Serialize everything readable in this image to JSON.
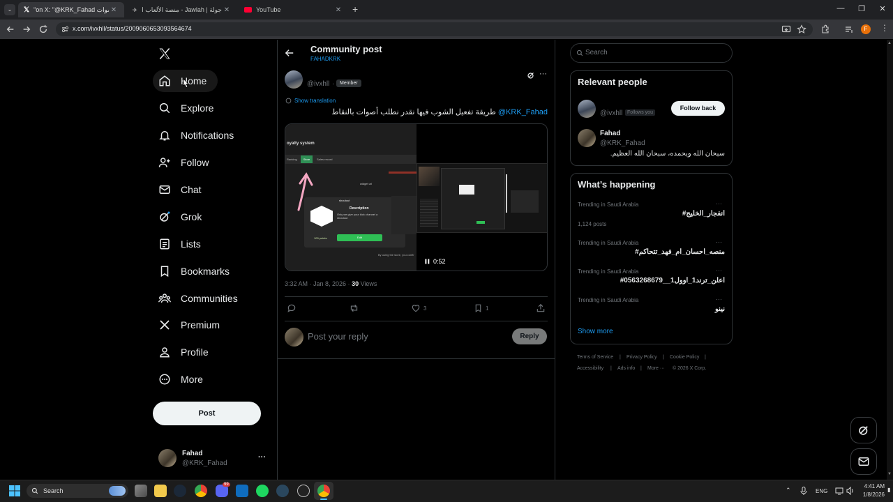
{
  "browser": {
    "tabs": [
      {
        "label": "\"on X: \"@KRK_Fahad بالنقاط أصوات",
        "favicon": "x-icon"
      },
      {
        "label": "جولة | Jawlah - منصة الألعاب الت...",
        "favicon": "jawlah-icon"
      },
      {
        "label": "YouTube",
        "favicon": "youtube-icon"
      }
    ],
    "url": "x.com/ivxhll/status/2009060653093564674",
    "profile_initial": "F"
  },
  "sidebar": {
    "nav": [
      {
        "label": "Home",
        "icon": "home-icon"
      },
      {
        "label": "Explore",
        "icon": "search-icon"
      },
      {
        "label": "Notifications",
        "icon": "bell-icon"
      },
      {
        "label": "Follow",
        "icon": "person-add-icon"
      },
      {
        "label": "Chat",
        "icon": "mail-icon"
      },
      {
        "label": "Grok",
        "icon": "grok-icon"
      },
      {
        "label": "Lists",
        "icon": "list-icon"
      },
      {
        "label": "Bookmarks",
        "icon": "bookmark-icon"
      },
      {
        "label": "Communities",
        "icon": "communities-icon"
      },
      {
        "label": "Premium",
        "icon": "x-icon"
      },
      {
        "label": "Profile",
        "icon": "person-icon"
      },
      {
        "label": "More",
        "icon": "more-circle-icon"
      }
    ],
    "post_label": "Post",
    "account": {
      "name": "Fahad",
      "handle": "@KRK_Fahad",
      "more": "···"
    }
  },
  "header": {
    "title": "Community post",
    "subtitle": "FAHADKRK"
  },
  "post": {
    "author_handle": "@ivxhll",
    "dot": "·",
    "badge": "Member",
    "show_translation": "Show translation",
    "mention": "@KRK_Fahad",
    "text": " طريقة تفعيل الشوب فيها نقدر نطلب أصوات بالنقاط",
    "video": {
      "time": "0:52",
      "left_title": "oyalty system",
      "left_tab1": "Ranking",
      "left_tab2": "Store",
      "left_tab3": "Sales record",
      "left_widget": "widget url",
      "left_shoutout": "shoutout",
      "left_desc_title": "Description",
      "left_desc": "Only we give your kick channel a shoutout",
      "left_points": "100 points",
      "left_edit": "Edit",
      "left_footer": "By using the store, you confir"
    },
    "timestamp": "3:32 AM · Jan 8, 2026 · ",
    "views_count": "30",
    "views_label": " Views",
    "likes": "3",
    "bookmarks": "1",
    "reply_placeholder": "Post your reply",
    "reply_button": "Reply"
  },
  "right": {
    "search_placeholder": "Search",
    "relevant_title": "Relevant people",
    "people": [
      {
        "handle": "@ivxhll",
        "follows_you": "Follows you",
        "action": "Follow back"
      },
      {
        "name": "Fahad",
        "handle": "@KRK_Fahad",
        "bio": "سبحان الله وبحمده، سبحان الله العظيم."
      }
    ],
    "happening_title": "What’s happening",
    "trends": [
      {
        "meta": "Trending in Saudi Arabia",
        "tag": "#انفجار_الخليج",
        "posts": "1,124 posts"
      },
      {
        "meta": "Trending in Saudi Arabia",
        "tag": "#منصه_احسان_ام_فهد_تتحاكم",
        "posts": ""
      },
      {
        "meta": "Trending in Saudi Arabia",
        "tag": "#اعلن_ترند1_اوول1__0563268679",
        "posts": ""
      },
      {
        "meta": "Trending in Saudi Arabia",
        "tag": "نينو",
        "posts": ""
      }
    ],
    "trend_more": "···",
    "show_more": "Show more",
    "footer": [
      "Terms of Service",
      "|",
      "Privacy Policy",
      "|",
      "Cookie Policy",
      "|",
      "Accessibility",
      "|",
      "Ads info",
      "|",
      "More ···",
      "© 2026 X Corp."
    ]
  },
  "taskbar": {
    "search_label": "Search",
    "lang": "ENG",
    "time": "4:41 AM",
    "date": "1/8/2026",
    "discord_badge": "99"
  },
  "colors": {
    "accent": "#1d9bf0",
    "background": "#000000",
    "border": "#2f3336",
    "muted": "#71767b"
  }
}
